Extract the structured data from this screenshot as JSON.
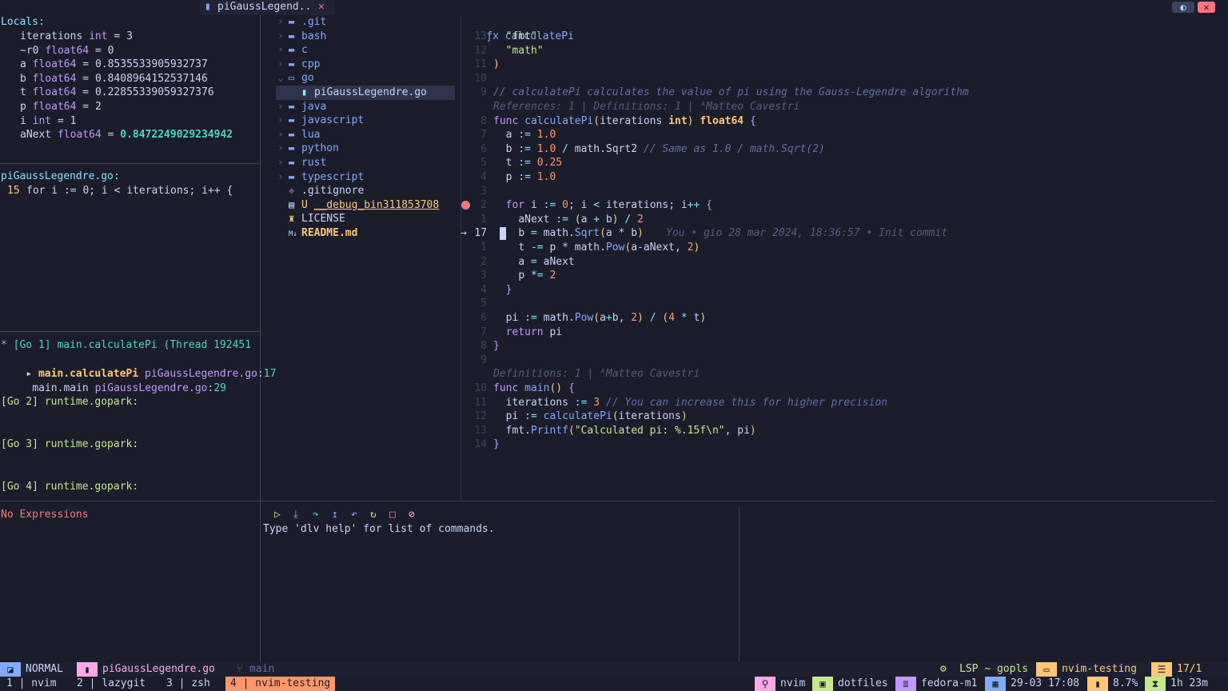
{
  "tabline": {
    "tab_title": "piGaussLegend..",
    "close_glyph": "✕"
  },
  "window_controls": {
    "toggle": "◐",
    "close": "✕"
  },
  "locals": {
    "header": "Locals:",
    "vars": [
      {
        "name": "iterations",
        "type": "int",
        "value": "3"
      },
      {
        "name": "~r0",
        "type": "float64",
        "value": "0"
      },
      {
        "name": "a",
        "type": "float64",
        "value": "0.8535533905932737"
      },
      {
        "name": "b",
        "type": "float64",
        "value": "0.8408964152537146"
      },
      {
        "name": "t",
        "type": "float64",
        "value": "0.22855339059327376"
      },
      {
        "name": "p",
        "type": "float64",
        "value": "2"
      },
      {
        "name": "i",
        "type": "int",
        "value": "1"
      },
      {
        "name": "aNext",
        "type": "float64",
        "value": "0.8472249029234942"
      }
    ]
  },
  "breakpoints_panel": {
    "file": "piGaussLegendre.go:",
    "line_no": "15",
    "code": "for i := 0; i < iterations; i++ {"
  },
  "stacks_panel": {
    "thread_header": "* [Go 1] main.calculatePi (Thread 192451",
    "frames": [
      {
        "func": "main.calculatePi",
        "file": "piGaussLegendre.go",
        "line": "17"
      },
      {
        "func": "main.main",
        "file": "piGaussLegendre.go",
        "line": "29"
      }
    ],
    "goroutines": [
      "[Go 2] runtime.gopark:",
      "[Go 3] runtime.gopark:",
      "[Go 4] runtime.gopark:"
    ]
  },
  "watches": {
    "empty": "No Expressions"
  },
  "file_tree": {
    "items": [
      {
        "label": ".git",
        "kind": "folder"
      },
      {
        "label": "bash",
        "kind": "folder"
      },
      {
        "label": "c",
        "kind": "folder"
      },
      {
        "label": "cpp",
        "kind": "folder"
      },
      {
        "label": "go",
        "kind": "folder-open"
      },
      {
        "label": "piGaussLegendre.go",
        "kind": "go-file"
      },
      {
        "label": "java",
        "kind": "folder"
      },
      {
        "label": "javascript",
        "kind": "folder"
      },
      {
        "label": "lua",
        "kind": "folder"
      },
      {
        "label": "python",
        "kind": "folder"
      },
      {
        "label": "rust",
        "kind": "folder"
      },
      {
        "label": "typescript",
        "kind": "folder"
      },
      {
        "label": ".gitignore",
        "kind": "git-file"
      },
      {
        "label": "__debug_bin311853708",
        "kind": "binary",
        "status": "U"
      },
      {
        "label": "LICENSE",
        "kind": "license"
      },
      {
        "label": "README.md",
        "kind": "markdown"
      }
    ]
  },
  "editor": {
    "breadcrumb": "calculatePi",
    "breadcrumb_icon": "ƒx",
    "lines": [
      {
        "n": "13",
        "code": "  \"fmt\""
      },
      {
        "n": "12",
        "code": "  \"math\""
      },
      {
        "n": "11",
        "code": ")"
      },
      {
        "n": "10",
        "code": ""
      },
      {
        "n": "9",
        "code": "// calculatePi calculates the value of pi using the Gauss-Legendre algorithm"
      },
      {
        "n": "",
        "code": "References: 1 | Definitions: 1 | ᴬMatteo Cavestri"
      },
      {
        "n": "8",
        "code": "func calculatePi(iterations int) float64 {"
      },
      {
        "n": "7",
        "code": "  a := 1.0"
      },
      {
        "n": "6",
        "code": "  b := 1.0 / math.Sqrt2 // Same as 1.0 / math.Sqrt(2)"
      },
      {
        "n": "5",
        "code": "  t := 0.25"
      },
      {
        "n": "4",
        "code": "  p := 1.0"
      },
      {
        "n": "3",
        "code": ""
      },
      {
        "n": "2",
        "code": "  for i := 0; i < iterations; i++ {"
      },
      {
        "n": "1",
        "code": "    aNext := (a + b) / 2"
      },
      {
        "n": "17",
        "code": "    b = math.Sqrt(a * b)"
      },
      {
        "n": "1",
        "code": "    t -= p * math.Pow(a-aNext, 2)"
      },
      {
        "n": "2",
        "code": "    a = aNext"
      },
      {
        "n": "3",
        "code": "    p *= 2"
      },
      {
        "n": "4",
        "code": "  }"
      },
      {
        "n": "5",
        "code": ""
      },
      {
        "n": "6",
        "code": "  pi := math.Pow(a+b, 2) / (4 * t)"
      },
      {
        "n": "7",
        "code": "  return pi"
      },
      {
        "n": "8",
        "code": "}"
      },
      {
        "n": "9",
        "code": ""
      },
      {
        "n": "",
        "code": "Definitions: 1 | ᴬMatteo Cavestri"
      },
      {
        "n": "10",
        "code": "func main() {"
      },
      {
        "n": "11",
        "code": "  iterations := 3 // You can increase this for higher precision"
      },
      {
        "n": "12",
        "code": "  pi := calculatePi(iterations)"
      },
      {
        "n": "13",
        "code": "  fmt.Printf(\"Calculated pi: %.15f\\n\", pi)"
      },
      {
        "n": "14",
        "code": "}"
      }
    ],
    "blame": "You • gio 28 mar 2024, 18:36:57 • Init commit",
    "current_line_marker": "→"
  },
  "repl": {
    "message": "Type 'dlv help' for list of commands."
  },
  "statusline": {
    "mode": "NORMAL",
    "file": "piGaussLegendre.go",
    "branch": "main",
    "lsp": "LSP ~ gopls",
    "project": "nvim-testing",
    "position": "17/1"
  },
  "tmux": {
    "windows": [
      "1 | nvim",
      "2 | lazygit",
      "3 | zsh",
      "4 | nvim-testing"
    ],
    "right": {
      "app": "nvim",
      "dir": "dotfiles",
      "host": "fedora-m1",
      "date": "29-03 17:08",
      "battery": "8.7%",
      "uptime": "1h 23m"
    }
  }
}
